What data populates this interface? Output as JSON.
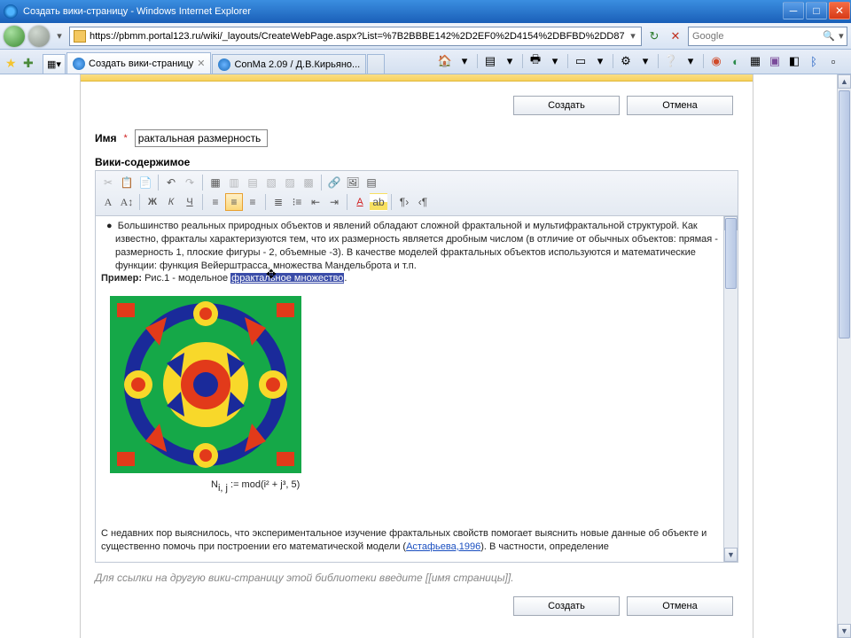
{
  "window": {
    "title": "Создать вики-страницу - Windows Internet Explorer"
  },
  "nav": {
    "url": "https://pbmm.portal123.ru/wiki/_layouts/CreateWebPage.aspx?List=%7B2BBBE142%2D2EF0%2D4154%2DBFBD%2DD87",
    "search_placeholder": "Google",
    "refresh_glyph": "↻",
    "stop_glyph": "✕"
  },
  "tabs": [
    {
      "label": "Создать вики-страницу",
      "active": true
    },
    {
      "label": "ConMa 2.09 / Д.В.Кирьяно...",
      "active": false
    }
  ],
  "page": {
    "create": "Создать",
    "cancel": "Отмена",
    "name_label": "Имя",
    "name_value": "рактальная размерность",
    "wiki_label": "Вики-содержимое",
    "hint": "Для ссылки на другую вики-страницу этой библиотеки введите [[имя страницы]].",
    "content": {
      "p1": "Большинство реальных природных объектов и явлений обладают сложной фрактальной и мультифрактальной структурой. Как известно, фракталы характеризуются тем, что их размерность является дробным числом (в отличие от обычных объектов: прямая - размерность 1, плоские фигуры - 2, объемные -3). В качестве моделей фрактальных объектов используются и математические функции: функция Вейерштрасса, множества Мандельброта и т.п.",
      "example_label": "Пример:",
      "example_text": "Рис.1 - модельное ",
      "highlight": "фрактальное множество",
      "formula": "N",
      "formula_sub": "i, j",
      "formula_rest": " := mod(i² + j³, 5)",
      "p2a": "С недавних пор выяснилось, что экспериментальное изучение фрактальных свойств помогает выяснить новые данные об объекте и существенно помочь при построении его математической модели (",
      "link": "Астафьева,1996",
      "p2b": "). В частности, определение"
    }
  },
  "icons": {
    "home": "🏠",
    "feed": "▤",
    "print": "🖶",
    "page": "▭",
    "tools": "⚙",
    "help": "?",
    "chev": "▾"
  }
}
